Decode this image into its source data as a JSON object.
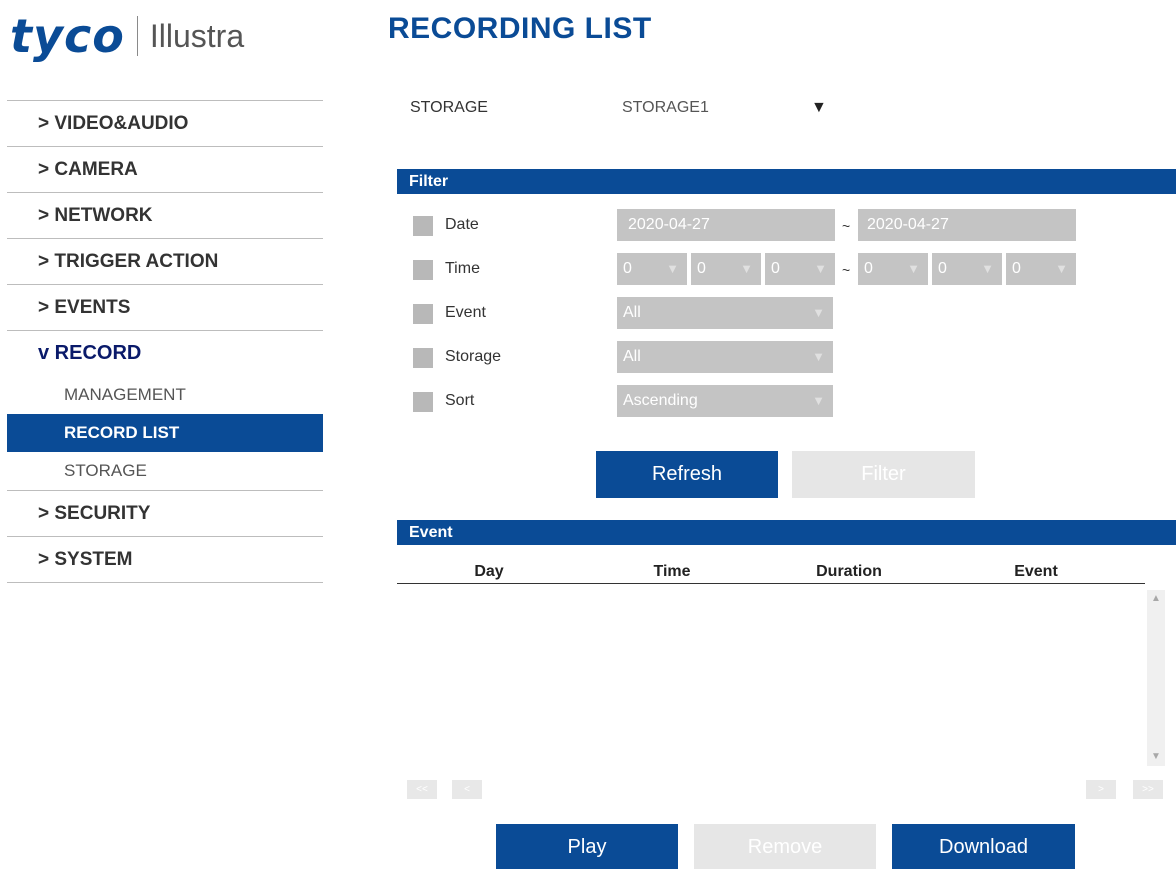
{
  "logo": {
    "brand": "tyco",
    "product": "Illustra"
  },
  "page_title": "RECORDING LIST",
  "sidebar": {
    "items": [
      {
        "label": "> VIDEO&AUDIO"
      },
      {
        "label": "> CAMERA"
      },
      {
        "label": "> NETWORK"
      },
      {
        "label": "> TRIGGER ACTION"
      },
      {
        "label": "> EVENTS"
      },
      {
        "label": "v RECORD"
      },
      {
        "label": "> SECURITY"
      },
      {
        "label": "> SYSTEM"
      }
    ],
    "record_sub": [
      {
        "label": "MANAGEMENT"
      },
      {
        "label": "RECORD LIST"
      },
      {
        "label": "STORAGE"
      }
    ]
  },
  "storage": {
    "label": "STORAGE",
    "value": "STORAGE1",
    "arrow": "▼"
  },
  "filter": {
    "title": "Filter",
    "date": {
      "label": "Date",
      "from": "2020-04-27",
      "to": "2020-04-27"
    },
    "time": {
      "label": "Time",
      "from_h": "0",
      "from_m": "0",
      "from_s": "0",
      "to_h": "0",
      "to_m": "0",
      "to_s": "0"
    },
    "event": {
      "label": "Event",
      "value": "All"
    },
    "storage": {
      "label": "Storage",
      "value": "All"
    },
    "sort": {
      "label": "Sort",
      "value": "Ascending"
    },
    "tilde": "~"
  },
  "buttons": {
    "refresh": "Refresh",
    "filter": "Filter",
    "play": "Play",
    "remove": "Remove",
    "download": "Download"
  },
  "event_section": {
    "title": "Event",
    "columns": [
      "Day",
      "Time",
      "Duration",
      "Event"
    ]
  },
  "pagination": {
    "first": "<<",
    "prev": "<",
    "next": ">",
    "last": ">>"
  },
  "colors": {
    "accent": "#0a4b96",
    "disabled": "#e6e6e6",
    "field": "#c4c4c4"
  }
}
